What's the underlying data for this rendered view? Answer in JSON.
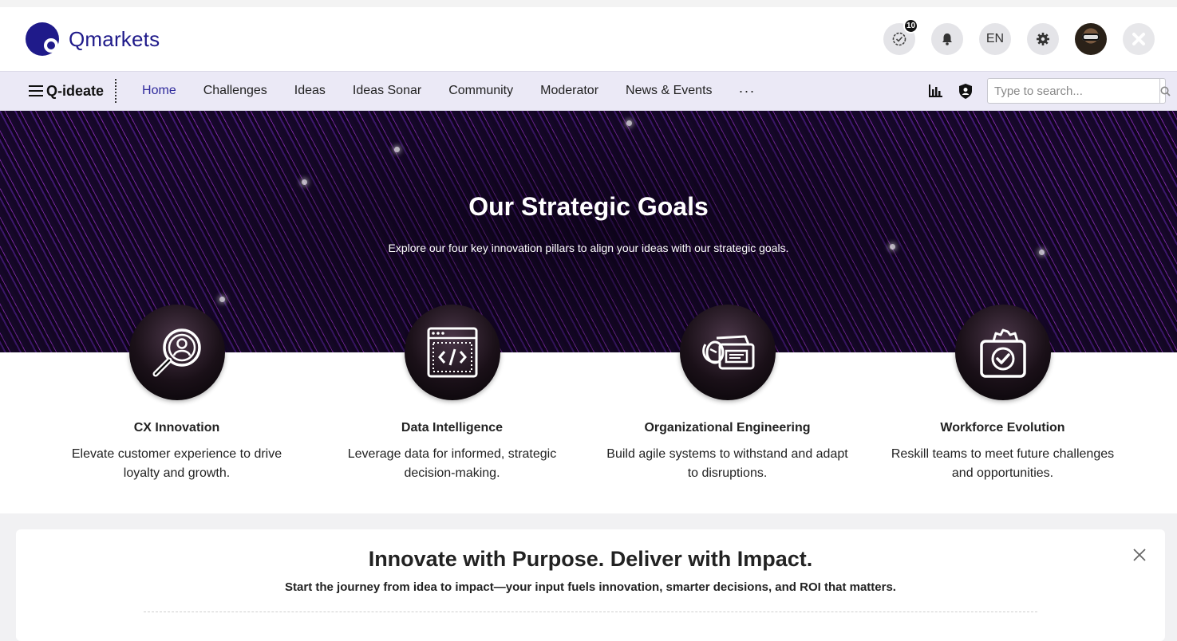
{
  "header": {
    "logo_text": "Qmarkets",
    "tasks_badge": "10",
    "language": "EN"
  },
  "nav": {
    "brand": "Q-ideate",
    "items": [
      {
        "label": "Home",
        "active": true
      },
      {
        "label": "Challenges"
      },
      {
        "label": "Ideas"
      },
      {
        "label": "Ideas Sonar"
      },
      {
        "label": "Community"
      },
      {
        "label": "Moderator"
      },
      {
        "label": "News & Events"
      }
    ],
    "more": "···",
    "search_placeholder": "Type to search..."
  },
  "hero": {
    "title": "Our Strategic Goals",
    "subtitle": "Explore our four key innovation pillars to align your ideas with our strategic goals."
  },
  "pillars": [
    {
      "icon": "magnifier-person-icon",
      "title": "CX Innovation",
      "description": "Elevate customer experience to drive loyalty and growth."
    },
    {
      "icon": "code-window-icon",
      "title": "Data Intelligence",
      "description": "Leverage data for informed, strategic decision-making."
    },
    {
      "icon": "hand-card-icon",
      "title": "Organizational Engineering",
      "description": "Build agile systems to withstand and adapt to disruptions."
    },
    {
      "icon": "gear-check-icon",
      "title": "Workforce Evolution",
      "description": "Reskill teams to meet future challenges and opportunities."
    }
  ],
  "banner": {
    "title": "Innovate with Purpose. Deliver with Impact.",
    "subtitle": "Start the journey from idea to impact—your input fuels innovation, smarter decisions, and ROI that matters."
  },
  "colors": {
    "brand": "#1f1a8a",
    "nav_bg": "#ebe9f6",
    "active_nav": "#2f2a9c"
  }
}
